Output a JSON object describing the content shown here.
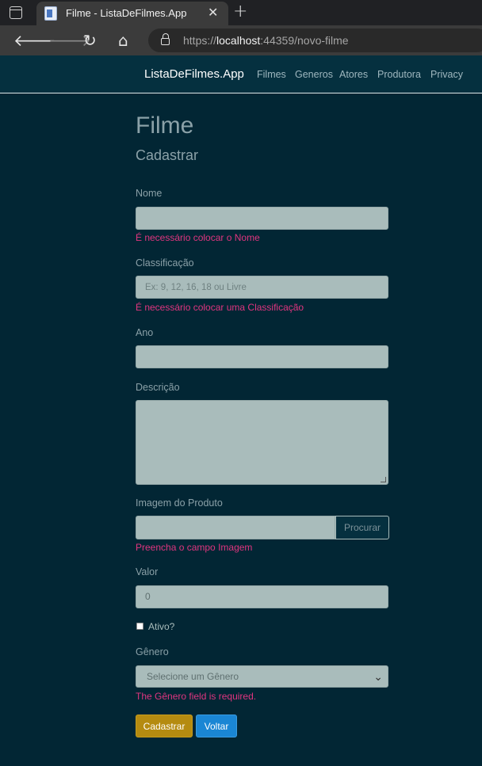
{
  "browser": {
    "tab_title": "Filme - ListaDeFilmes.App",
    "tab_close": "✕",
    "new_tab": "+",
    "url_scheme": "https://",
    "url_host": "localhost",
    "url_rest": ":44359/novo-filme"
  },
  "navbar": {
    "brand": "ListaDeFilmes.App",
    "links": [
      "Filmes",
      "Generos",
      "Atores",
      "Produtora",
      "Privacy"
    ]
  },
  "page": {
    "title": "Filme",
    "subtitle": "Cadastrar"
  },
  "form": {
    "nome_label": "Nome",
    "nome_value": "",
    "nome_error": "É necessário colocar o Nome",
    "classificacao_label": "Classificação",
    "classificacao_placeholder": "Ex: 9, 12, 16, 18 ou Livre",
    "classificacao_error": "É necessário colocar uma Classificação",
    "ano_label": "Ano",
    "ano_value": "",
    "descricao_label": "Descrição",
    "descricao_value": "",
    "imagem_label": "Imagem do Produto",
    "imagem_button": "Procurar",
    "imagem_error": "Preencha o campo Imagem",
    "valor_label": "Valor",
    "valor_value": "0",
    "ativo_label": "Ativo?",
    "ativo_checked": false,
    "genero_label": "Gênero",
    "genero_selected": "Selecione um Gênero",
    "genero_error": "The Gênero field is required.",
    "submit_label": "Cadastrar",
    "back_label": "Voltar"
  },
  "colors": {
    "background": "#022634",
    "error": "#e0357f",
    "submit": "#b58b10",
    "back": "#1a86d4"
  }
}
